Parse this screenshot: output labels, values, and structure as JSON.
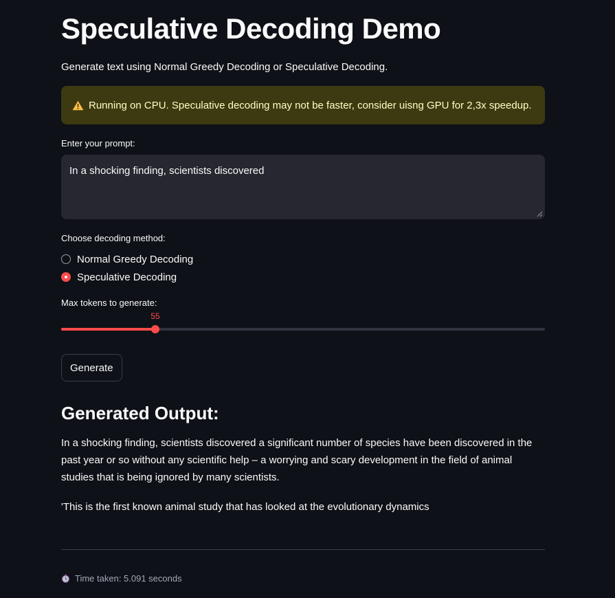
{
  "header": {
    "title": "Speculative Decoding Demo",
    "subtitle": "Generate text using Normal Greedy Decoding or Speculative Decoding."
  },
  "warning": {
    "icon": "warning-icon",
    "text": "Running on CPU. Speculative decoding may not be faster, consider uisng GPU for 2,3x speedup.",
    "color": "#ffffc2",
    "background": "#3d3a12"
  },
  "prompt": {
    "label": "Enter your prompt:",
    "value": "In a shocking finding, scientists discovered"
  },
  "decoding": {
    "label": "Choose decoding method:",
    "options": [
      {
        "label": "Normal Greedy Decoding",
        "selected": false
      },
      {
        "label": "Speculative Decoding",
        "selected": true
      }
    ]
  },
  "max_tokens": {
    "label": "Max tokens to generate:",
    "value": "55",
    "fraction": 0.195
  },
  "generate_button": {
    "label": "Generate"
  },
  "output": {
    "heading": "Generated Output:",
    "paragraphs": [
      "In a shocking finding, scientists discovered a significant number of species have been discovered in the past year or so without any scientific help – a worrying and scary development in the field of animal studies that is being ignored by many scientists.",
      "'This is the first known animal study that has looked at the evolutionary dynamics"
    ]
  },
  "footer": {
    "icon": "stopwatch-icon",
    "time_text": "Time taken: 5.091 seconds"
  },
  "colors": {
    "accent": "#ff4b4b",
    "background": "#0e1117",
    "input_background": "#262730"
  }
}
